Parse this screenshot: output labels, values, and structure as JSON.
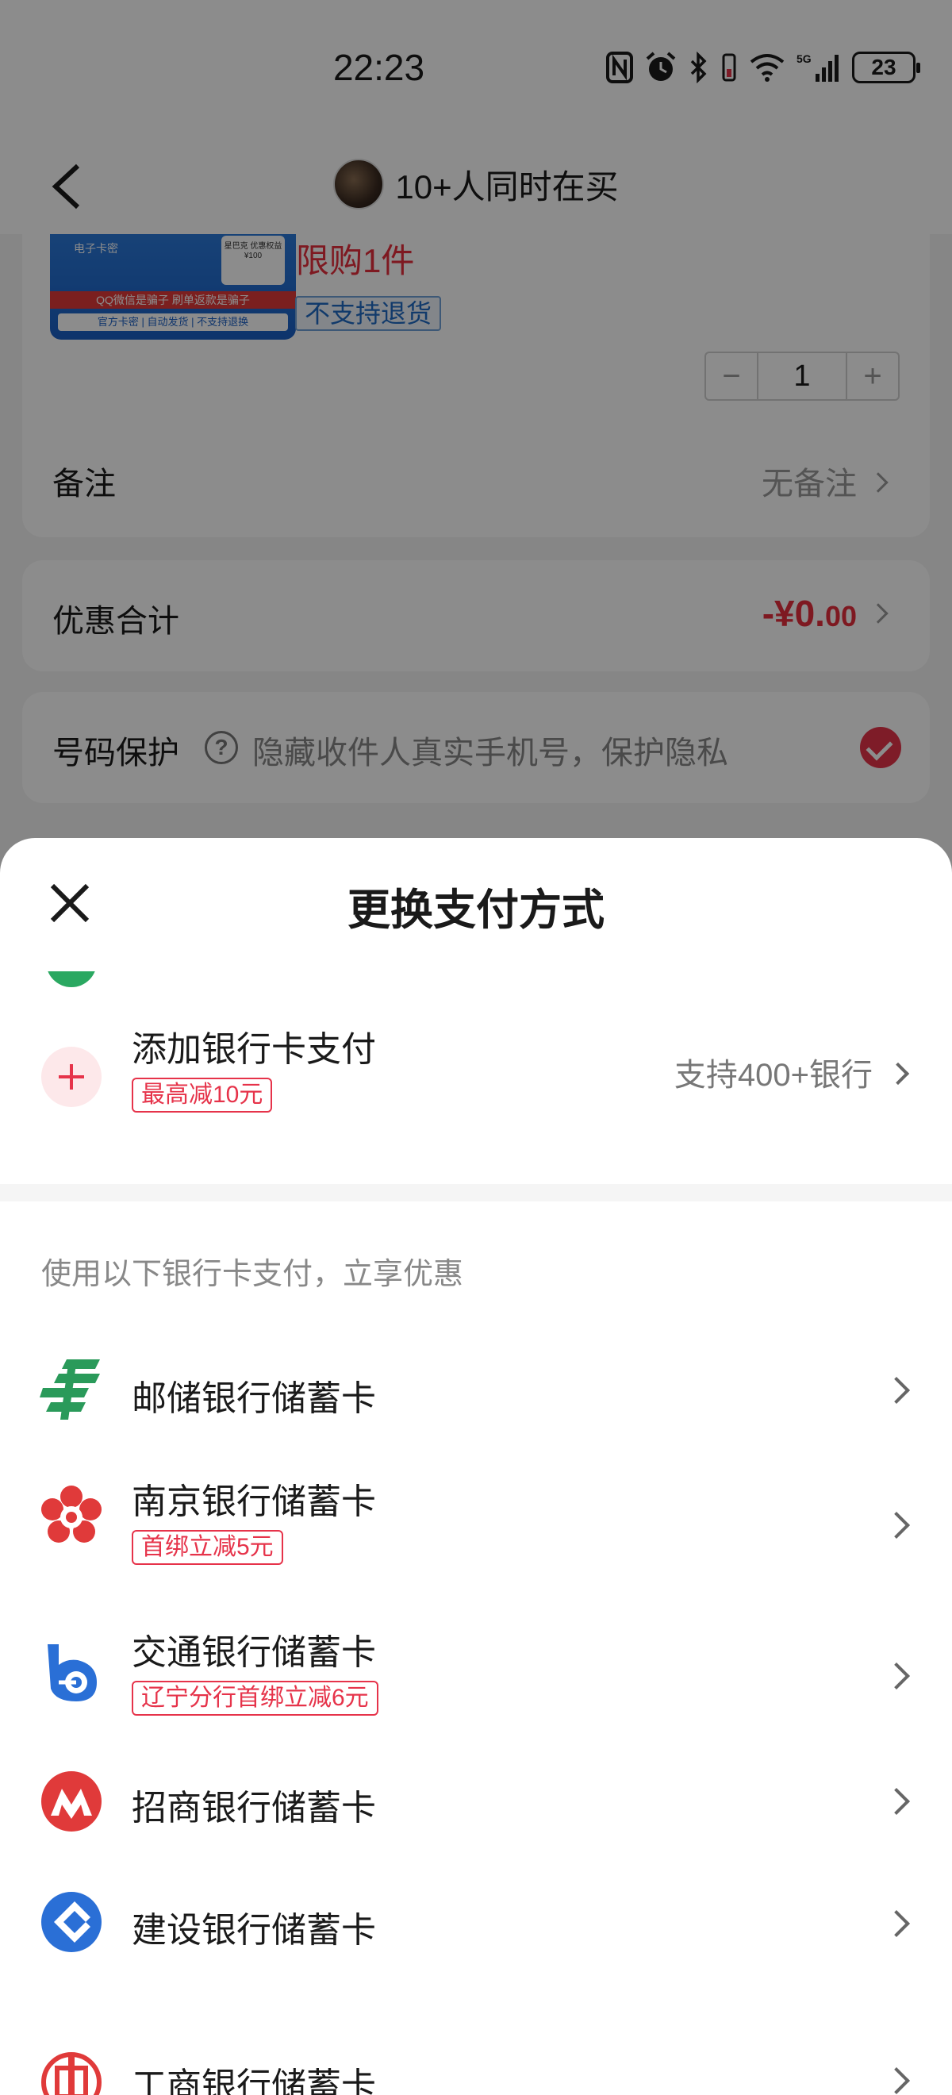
{
  "status_bar": {
    "time": "22:23",
    "battery": "23"
  },
  "nav": {
    "title": "10+人同时在买"
  },
  "product": {
    "image_label": "电子卡密",
    "image_card_text": "星巴克 优惠权益 ¥100",
    "image_red_text": "QQ微信是骗子 刷单返款是骗子",
    "image_blue_text": "官方卡密 | 自动发货 | 不支持退换",
    "limit": "限购1件",
    "return_policy": "不支持退货",
    "quantity": "1",
    "minus": "−",
    "plus": "+"
  },
  "remark": {
    "label": "备注",
    "value": "无备注"
  },
  "discount": {
    "label": "优惠合计",
    "value_main": "-¥0.",
    "value_cents": "00"
  },
  "privacy": {
    "label": "号码保护",
    "help": "?",
    "hint": "隐藏收件人真实手机号，保护隐私",
    "checked": true
  },
  "sheet": {
    "title": "更换支付方式",
    "add_card": {
      "label": "添加银行卡支付",
      "tag": "最高减10元",
      "right": "支持400+银行"
    },
    "section_hint": "使用以下银行卡支付，立享优惠",
    "banks": [
      {
        "name": "邮储银行储蓄卡",
        "tag": "",
        "icon": "psbc-logo-icon"
      },
      {
        "name": "南京银行储蓄卡",
        "tag": "首绑立减5元",
        "icon": "bank-of-nanjing-logo-icon"
      },
      {
        "name": "交通银行储蓄卡",
        "tag": "辽宁分行首绑立减6元",
        "icon": "bocom-logo-icon"
      },
      {
        "name": "招商银行储蓄卡",
        "tag": "",
        "icon": "cmb-logo-icon"
      },
      {
        "name": "建设银行储蓄卡",
        "tag": "",
        "icon": "ccb-logo-icon"
      },
      {
        "name": "工商银行储蓄卡",
        "tag": "",
        "icon": "icbc-logo-icon"
      }
    ]
  },
  "colors": {
    "accent_red": "#e6334a",
    "overlay": "rgba(0,0,0,0.45)"
  }
}
